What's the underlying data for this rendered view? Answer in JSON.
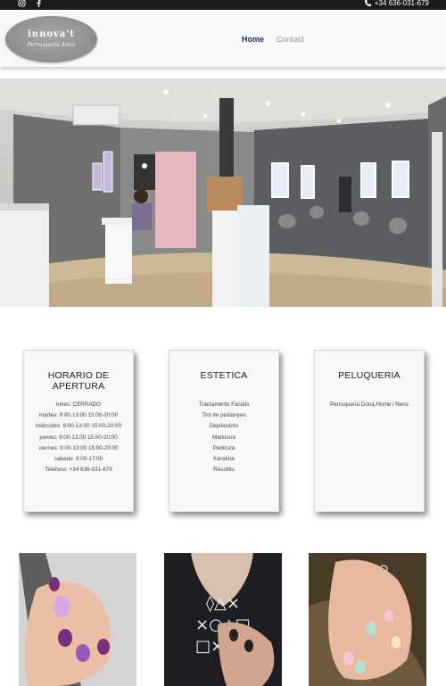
{
  "topbar": {
    "icons": [
      "instagram-icon",
      "facebook-icon",
      "phone-icon"
    ],
    "phone": "+34 636-031-679"
  },
  "header": {
    "logo_text": "innova't",
    "logo_subtext": "Perruqueria Anna",
    "nav": {
      "home": "Home",
      "contact": "Contact"
    }
  },
  "cards": {
    "horario": {
      "title": "HORARIO DE APERTURA",
      "lines": [
        "lunes: CERRADO",
        "martes: 9:00-13:00 15:00-20:00",
        "miércoles: 9:00-13:00 15:00-20:00",
        "jueves: 9:00-13:00 15:00-20:00",
        "viernes: 9:00-13:00 15:00-20:00",
        "sabado: 9:00-17:00",
        "Telefono: +34 636-031-679"
      ]
    },
    "estetica": {
      "title": "ESTETICA",
      "lines": [
        "Tractaments Facials",
        "Tint de pestanyes",
        "Depilacions",
        "Manicura",
        "Pedicura",
        "Keratina",
        "Recollits"
      ]
    },
    "peluqueria": {
      "title": "PELUQUERIA",
      "lines": [
        "Perruqueria Dona,Home i Nens"
      ]
    }
  },
  "colors": {
    "topbar_bg": "#1b1b1b",
    "header_bg": "#f6f7f9",
    "nav_active": "#2a2a5a",
    "nav_inactive": "#9a9a9a",
    "card_bg": "#f7f8fa"
  }
}
